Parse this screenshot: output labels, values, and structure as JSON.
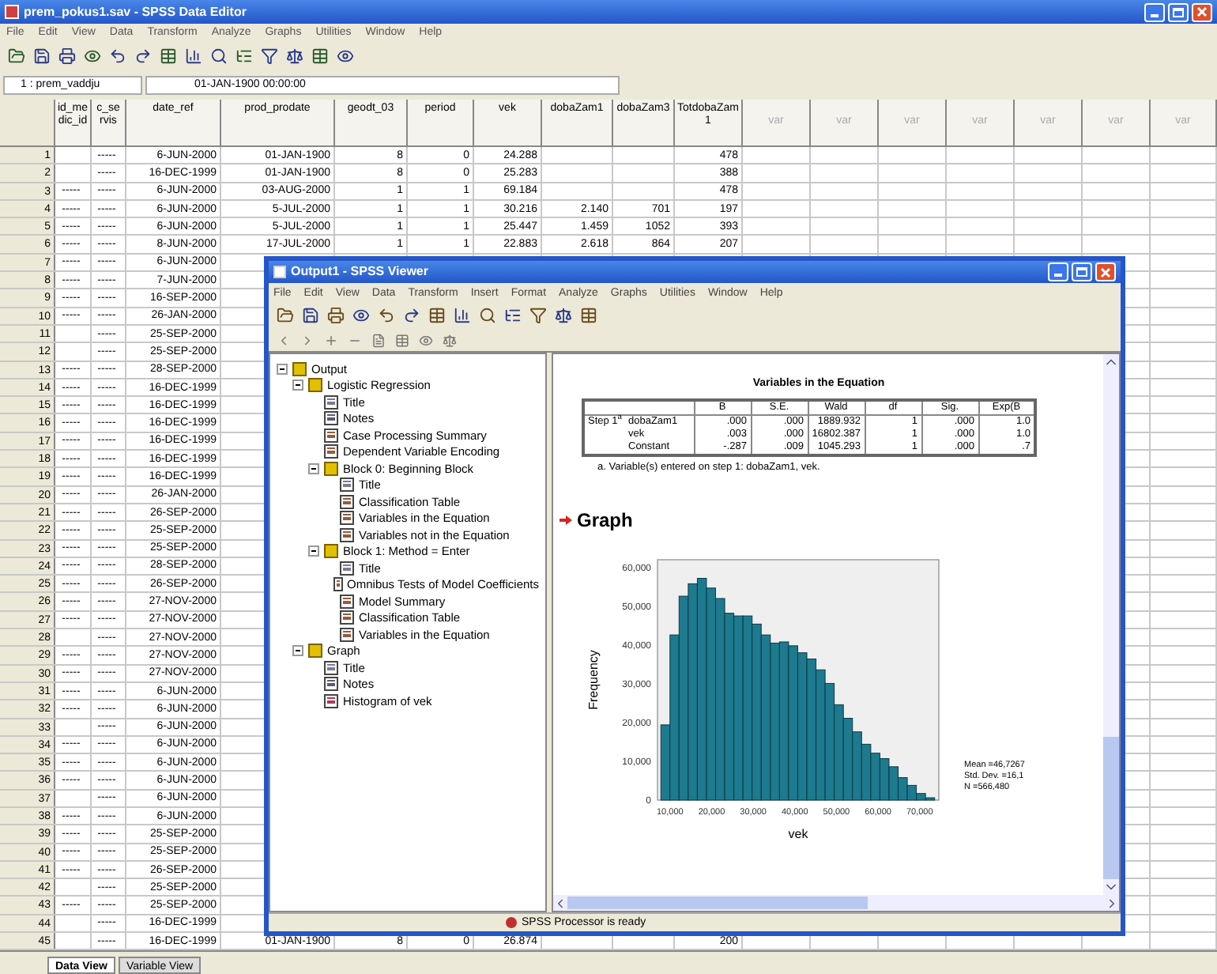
{
  "editor": {
    "title": "prem_pokus1.sav - SPSS Data Editor",
    "menu": [
      "File",
      "Edit",
      "View",
      "Data",
      "Transform",
      "Analyze",
      "Graphs",
      "Utilities",
      "Window",
      "Help"
    ],
    "cell_ref": "1 : prem_vaddju",
    "cell_value": "01-JAN-1900 00:00:00",
    "columns": [
      "id_medic_id",
      "c_se rvis",
      "date_ref",
      "prod_prodate",
      "geodt_03",
      "period",
      "vek",
      "dobaZam1",
      "dobaZam3",
      "TotdobaZam1",
      "var",
      "var",
      "var",
      "var",
      "var",
      "var",
      "var"
    ],
    "rows": [
      {
        "n": "1",
        "cells": [
          null,
          "-----",
          "6-JUN-2000",
          "01-JAN-1900",
          "8",
          "0",
          "24.288",
          null,
          null,
          "478"
        ]
      },
      {
        "n": "2",
        "cells": [
          null,
          "-----",
          "16-DEC-1999",
          "01-JAN-1900",
          "8",
          "0",
          "25.283",
          null,
          null,
          "388"
        ]
      },
      {
        "n": "3",
        "cells": [
          "-----",
          "-----",
          "6-JUN-2000",
          "03-AUG-2000",
          "1",
          "1",
          "69.184",
          null,
          null,
          "478"
        ]
      },
      {
        "n": "4",
        "cells": [
          "-----",
          "-----",
          "6-JUN-2000",
          "5-JUL-2000",
          "1",
          "1",
          "30.216",
          "2.140",
          "701",
          "197"
        ]
      },
      {
        "n": "5",
        "cells": [
          "-----",
          "-----",
          "6-JUN-2000",
          "5-JUL-2000",
          "1",
          "1",
          "25.447",
          "1.459",
          "1052",
          "393"
        ]
      },
      {
        "n": "6",
        "cells": [
          "-----",
          "-----",
          "8-JUN-2000",
          "17-JUL-2000",
          "1",
          "1",
          "22.883",
          "2.618",
          "864",
          "207"
        ]
      },
      {
        "n": "7",
        "cells": [
          "-----",
          "-----",
          "6-JUN-2000"
        ]
      },
      {
        "n": "8",
        "cells": [
          "-----",
          "-----",
          "7-JUN-2000"
        ]
      },
      {
        "n": "9",
        "cells": [
          "-----",
          "-----",
          "16-SEP-2000"
        ]
      },
      {
        "n": "10",
        "cells": [
          "-----",
          "-----",
          "26-JAN-2000"
        ]
      },
      {
        "n": "11",
        "cells": [
          null,
          "-----",
          "25-SEP-2000"
        ]
      },
      {
        "n": "12",
        "cells": [
          null,
          "-----",
          "25-SEP-2000"
        ]
      },
      {
        "n": "13",
        "cells": [
          "-----",
          "-----",
          "28-SEP-2000"
        ]
      },
      {
        "n": "14",
        "cells": [
          "-----",
          "-----",
          "16-DEC-1999"
        ]
      },
      {
        "n": "15",
        "cells": [
          "-----",
          "-----",
          "16-DEC-1999"
        ]
      },
      {
        "n": "16",
        "cells": [
          "-----",
          "-----",
          "16-DEC-1999"
        ]
      },
      {
        "n": "17",
        "cells": [
          "-----",
          "-----",
          "16-DEC-1999"
        ]
      },
      {
        "n": "18",
        "cells": [
          "-----",
          "-----",
          "16-DEC-1999"
        ]
      },
      {
        "n": "19",
        "cells": [
          "-----",
          "-----",
          "16-DEC-1999"
        ]
      },
      {
        "n": "20",
        "cells": [
          "-----",
          "-----",
          "26-JAN-2000"
        ]
      },
      {
        "n": "21",
        "cells": [
          "-----",
          "-----",
          "26-SEP-2000"
        ]
      },
      {
        "n": "22",
        "cells": [
          "-----",
          "-----",
          "25-SEP-2000"
        ]
      },
      {
        "n": "23",
        "cells": [
          "-----",
          "-----",
          "25-SEP-2000"
        ]
      },
      {
        "n": "24",
        "cells": [
          "-----",
          "-----",
          "28-SEP-2000"
        ]
      },
      {
        "n": "25",
        "cells": [
          "-----",
          "-----",
          "26-SEP-2000"
        ]
      },
      {
        "n": "26",
        "cells": [
          "-----",
          "-----",
          "27-NOV-2000"
        ]
      },
      {
        "n": "27",
        "cells": [
          "-----",
          "-----",
          "27-NOV-2000"
        ]
      },
      {
        "n": "28",
        "cells": [
          null,
          "-----",
          "27-NOV-2000"
        ]
      },
      {
        "n": "29",
        "cells": [
          "-----",
          "-----",
          "27-NOV-2000"
        ]
      },
      {
        "n": "30",
        "cells": [
          "-----",
          "-----",
          "27-NOV-2000"
        ]
      },
      {
        "n": "31",
        "cells": [
          "-----",
          "-----",
          "6-JUN-2000"
        ]
      },
      {
        "n": "32",
        "cells": [
          "-----",
          "-----",
          "6-JUN-2000"
        ]
      },
      {
        "n": "33",
        "cells": [
          null,
          "-----",
          "6-JUN-2000"
        ]
      },
      {
        "n": "34",
        "cells": [
          "-----",
          "-----",
          "6-JUN-2000"
        ]
      },
      {
        "n": "35",
        "cells": [
          "-----",
          "-----",
          "6-JUN-2000"
        ]
      },
      {
        "n": "36",
        "cells": [
          "-----",
          "-----",
          "6-JUN-2000"
        ]
      },
      {
        "n": "37",
        "cells": [
          null,
          "-----",
          "6-JUN-2000"
        ]
      },
      {
        "n": "38",
        "cells": [
          "-----",
          "-----",
          "6-JUN-2000"
        ]
      },
      {
        "n": "39",
        "cells": [
          "-----",
          "-----",
          "25-SEP-2000"
        ]
      },
      {
        "n": "40",
        "cells": [
          "-----",
          "-----",
          "25-SEP-2000"
        ]
      },
      {
        "n": "41",
        "cells": [
          "-----",
          "-----",
          "26-SEP-2000"
        ]
      },
      {
        "n": "42",
        "cells": [
          null,
          "-----",
          "25-SEP-2000"
        ]
      },
      {
        "n": "43",
        "cells": [
          "-----",
          "-----",
          "25-SEP-2000"
        ]
      },
      {
        "n": "44",
        "cells": [
          null,
          "-----",
          "16-DEC-1999"
        ]
      },
      {
        "n": "45",
        "cells": [
          null,
          "-----",
          "16-DEC-1999",
          "01-JAN-1900",
          "8",
          "0",
          "26.874",
          null,
          null,
          "200"
        ]
      }
    ],
    "sheet_tabs": [
      {
        "label": "Data View",
        "selected": true
      },
      {
        "label": "Variable View",
        "selected": false
      }
    ]
  },
  "viewer": {
    "title": "Output1 - SPSS Viewer",
    "menu": [
      "File",
      "Edit",
      "View",
      "Data",
      "Transform",
      "Insert",
      "Format",
      "Analyze",
      "Graphs",
      "Utilities",
      "Window",
      "Help"
    ],
    "outline": [
      {
        "label": "Output",
        "kind": "book",
        "expanded": true,
        "children": [
          {
            "label": "Logistic Regression",
            "kind": "book",
            "expanded": true,
            "children": [
              {
                "label": "Title",
                "kind": "title"
              },
              {
                "label": "Notes",
                "kind": "notes"
              },
              {
                "label": "Case Processing Summary",
                "kind": "table"
              },
              {
                "label": "Dependent Variable Encoding",
                "kind": "table"
              },
              {
                "label": "Block 0: Beginning Block",
                "kind": "book",
                "expanded": true,
                "children": [
                  {
                    "label": "Title",
                    "kind": "title"
                  },
                  {
                    "label": "Classification Table",
                    "kind": "table"
                  },
                  {
                    "label": "Variables in the Equation",
                    "kind": "table"
                  },
                  {
                    "label": "Variables not in the Equation",
                    "kind": "table"
                  }
                ]
              },
              {
                "label": "Block 1: Method = Enter",
                "kind": "book",
                "expanded": true,
                "children": [
                  {
                    "label": "Title",
                    "kind": "title"
                  },
                  {
                    "label": "Omnibus Tests of Model Coefficients",
                    "kind": "table"
                  },
                  {
                    "label": "Model Summary",
                    "kind": "table"
                  },
                  {
                    "label": "Classification Table",
                    "kind": "table"
                  },
                  {
                    "label": "Variables in the Equation",
                    "kind": "table"
                  }
                ]
              }
            ]
          },
          {
            "label": "Graph",
            "kind": "book",
            "expanded": true,
            "children": [
              {
                "label": "Title",
                "kind": "title"
              },
              {
                "label": "Notes",
                "kind": "notes"
              },
              {
                "label": "Histogram of vek",
                "kind": "chart"
              }
            ]
          }
        ]
      }
    ],
    "table": {
      "title": "Variables in the Equation",
      "columns": [
        "B",
        "S.E.",
        "Wald",
        "df",
        "Sig.",
        "Exp(B"
      ],
      "rows": [
        {
          "step": "Step 1$^{a}$",
          "name": "dobaZam1",
          "values": [
            ".000",
            ".000",
            "1889.932",
            "1",
            ".000",
            "1.0"
          ]
        },
        {
          "name": "vek",
          "values": [
            ".003",
            ".000",
            "16802.387",
            "1",
            ".000",
            "1.0"
          ]
        },
        {
          "name": "Constant",
          "values": [
            "-.287",
            ".009",
            "1045.293",
            "1",
            ".000",
            ".7"
          ]
        }
      ],
      "footnote": "a. Variable(s) entered on step 1: dobaZam1, vek."
    },
    "graph_heading": "Graph",
    "chart_data": {
      "type": "bar",
      "xlabel": "vek",
      "ylabel": "Frequency",
      "xlim": [
        7000,
        74600
      ],
      "x": [
        8900,
        11090,
        13280,
        15480,
        17670,
        19860,
        22060,
        24250,
        26440,
        28640,
        30830,
        33020,
        35220,
        37410,
        39600,
        41800,
        43990,
        46180,
        48370,
        50570,
        52760,
        54950,
        57150,
        59340,
        61530,
        63730,
        65920,
        68110,
        70310,
        72500
      ],
      "ylim": [
        0,
        62000
      ],
      "xticks": [
        {
          "value": 10000,
          "label": "10,000"
        },
        {
          "value": 20000,
          "label": "20,000"
        },
        {
          "value": 30000,
          "label": "30,000"
        },
        {
          "value": 40000,
          "label": "40,000"
        },
        {
          "value": 50000,
          "label": "50,000"
        },
        {
          "value": 60000,
          "label": "60,000"
        },
        {
          "value": 70000,
          "label": "70,000"
        }
      ],
      "yticks": [
        {
          "value": 0,
          "label": "0"
        },
        {
          "value": 10000,
          "label": "10,000"
        },
        {
          "value": 20000,
          "label": "20,000"
        },
        {
          "value": 30000,
          "label": "30,000"
        },
        {
          "value": 40000,
          "label": "40,000"
        },
        {
          "value": 50000,
          "label": "50,000"
        },
        {
          "value": 60000,
          "label": "60,000"
        }
      ],
      "series": [
        {
          "color": "#1d7a8f",
          "values": [
            19400,
            42600,
            52600,
            55800,
            57200,
            54700,
            52000,
            48200,
            47500,
            47500,
            45400,
            42600,
            40500,
            40800,
            39800,
            38000,
            36400,
            33600,
            30100,
            24600,
            21100,
            17600,
            14400,
            12100,
            10700,
            8600,
            5800,
            3800,
            1700,
            600
          ]
        }
      ]
    },
    "legend": [
      "Mean =46,7267",
      "Std. Dev. =16,1",
      "N =566,480"
    ],
    "status": "SPSS Processor is ready"
  }
}
